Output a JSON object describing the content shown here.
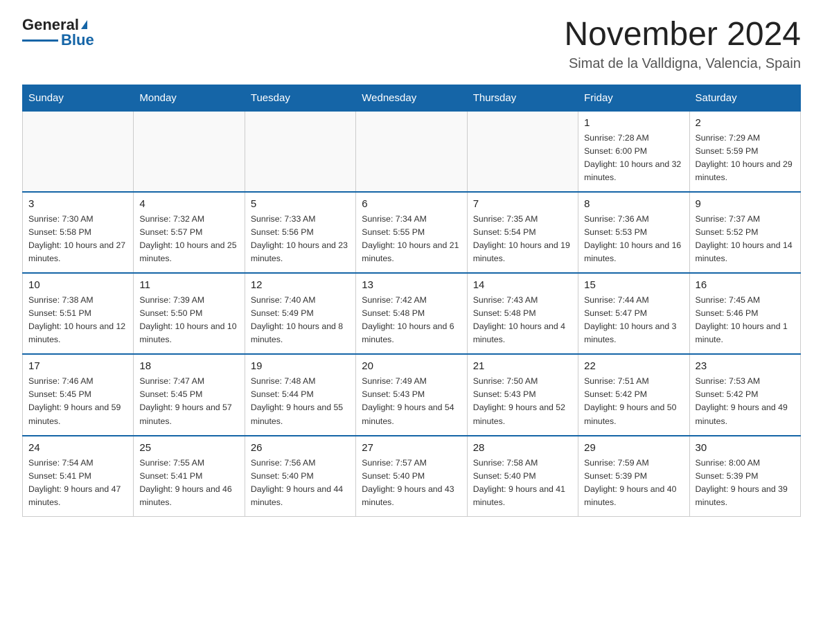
{
  "header": {
    "logo_main": "General",
    "logo_accent": "Blue",
    "month_title": "November 2024",
    "location": "Simat de la Valldigna, Valencia, Spain"
  },
  "weekdays": [
    "Sunday",
    "Monday",
    "Tuesday",
    "Wednesday",
    "Thursday",
    "Friday",
    "Saturday"
  ],
  "weeks": [
    [
      {
        "day": "",
        "info": ""
      },
      {
        "day": "",
        "info": ""
      },
      {
        "day": "",
        "info": ""
      },
      {
        "day": "",
        "info": ""
      },
      {
        "day": "",
        "info": ""
      },
      {
        "day": "1",
        "info": "Sunrise: 7:28 AM\nSunset: 6:00 PM\nDaylight: 10 hours and 32 minutes."
      },
      {
        "day": "2",
        "info": "Sunrise: 7:29 AM\nSunset: 5:59 PM\nDaylight: 10 hours and 29 minutes."
      }
    ],
    [
      {
        "day": "3",
        "info": "Sunrise: 7:30 AM\nSunset: 5:58 PM\nDaylight: 10 hours and 27 minutes."
      },
      {
        "day": "4",
        "info": "Sunrise: 7:32 AM\nSunset: 5:57 PM\nDaylight: 10 hours and 25 minutes."
      },
      {
        "day": "5",
        "info": "Sunrise: 7:33 AM\nSunset: 5:56 PM\nDaylight: 10 hours and 23 minutes."
      },
      {
        "day": "6",
        "info": "Sunrise: 7:34 AM\nSunset: 5:55 PM\nDaylight: 10 hours and 21 minutes."
      },
      {
        "day": "7",
        "info": "Sunrise: 7:35 AM\nSunset: 5:54 PM\nDaylight: 10 hours and 19 minutes."
      },
      {
        "day": "8",
        "info": "Sunrise: 7:36 AM\nSunset: 5:53 PM\nDaylight: 10 hours and 16 minutes."
      },
      {
        "day": "9",
        "info": "Sunrise: 7:37 AM\nSunset: 5:52 PM\nDaylight: 10 hours and 14 minutes."
      }
    ],
    [
      {
        "day": "10",
        "info": "Sunrise: 7:38 AM\nSunset: 5:51 PM\nDaylight: 10 hours and 12 minutes."
      },
      {
        "day": "11",
        "info": "Sunrise: 7:39 AM\nSunset: 5:50 PM\nDaylight: 10 hours and 10 minutes."
      },
      {
        "day": "12",
        "info": "Sunrise: 7:40 AM\nSunset: 5:49 PM\nDaylight: 10 hours and 8 minutes."
      },
      {
        "day": "13",
        "info": "Sunrise: 7:42 AM\nSunset: 5:48 PM\nDaylight: 10 hours and 6 minutes."
      },
      {
        "day": "14",
        "info": "Sunrise: 7:43 AM\nSunset: 5:48 PM\nDaylight: 10 hours and 4 minutes."
      },
      {
        "day": "15",
        "info": "Sunrise: 7:44 AM\nSunset: 5:47 PM\nDaylight: 10 hours and 3 minutes."
      },
      {
        "day": "16",
        "info": "Sunrise: 7:45 AM\nSunset: 5:46 PM\nDaylight: 10 hours and 1 minute."
      }
    ],
    [
      {
        "day": "17",
        "info": "Sunrise: 7:46 AM\nSunset: 5:45 PM\nDaylight: 9 hours and 59 minutes."
      },
      {
        "day": "18",
        "info": "Sunrise: 7:47 AM\nSunset: 5:45 PM\nDaylight: 9 hours and 57 minutes."
      },
      {
        "day": "19",
        "info": "Sunrise: 7:48 AM\nSunset: 5:44 PM\nDaylight: 9 hours and 55 minutes."
      },
      {
        "day": "20",
        "info": "Sunrise: 7:49 AM\nSunset: 5:43 PM\nDaylight: 9 hours and 54 minutes."
      },
      {
        "day": "21",
        "info": "Sunrise: 7:50 AM\nSunset: 5:43 PM\nDaylight: 9 hours and 52 minutes."
      },
      {
        "day": "22",
        "info": "Sunrise: 7:51 AM\nSunset: 5:42 PM\nDaylight: 9 hours and 50 minutes."
      },
      {
        "day": "23",
        "info": "Sunrise: 7:53 AM\nSunset: 5:42 PM\nDaylight: 9 hours and 49 minutes."
      }
    ],
    [
      {
        "day": "24",
        "info": "Sunrise: 7:54 AM\nSunset: 5:41 PM\nDaylight: 9 hours and 47 minutes."
      },
      {
        "day": "25",
        "info": "Sunrise: 7:55 AM\nSunset: 5:41 PM\nDaylight: 9 hours and 46 minutes."
      },
      {
        "day": "26",
        "info": "Sunrise: 7:56 AM\nSunset: 5:40 PM\nDaylight: 9 hours and 44 minutes."
      },
      {
        "day": "27",
        "info": "Sunrise: 7:57 AM\nSunset: 5:40 PM\nDaylight: 9 hours and 43 minutes."
      },
      {
        "day": "28",
        "info": "Sunrise: 7:58 AM\nSunset: 5:40 PM\nDaylight: 9 hours and 41 minutes."
      },
      {
        "day": "29",
        "info": "Sunrise: 7:59 AM\nSunset: 5:39 PM\nDaylight: 9 hours and 40 minutes."
      },
      {
        "day": "30",
        "info": "Sunrise: 8:00 AM\nSunset: 5:39 PM\nDaylight: 9 hours and 39 minutes."
      }
    ]
  ]
}
